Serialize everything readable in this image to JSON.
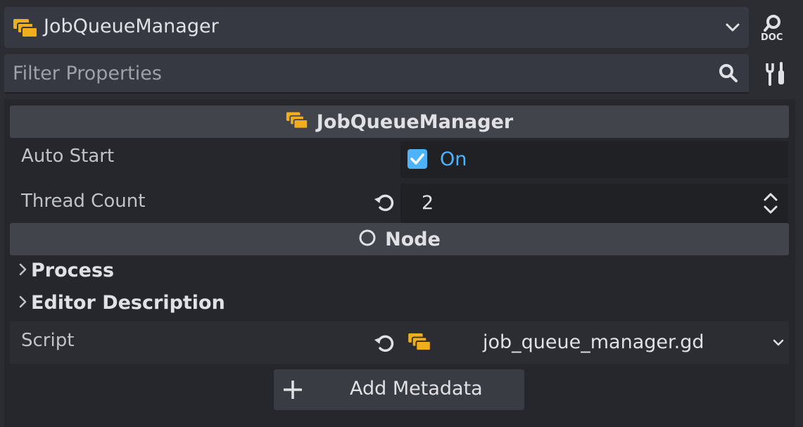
{
  "selector": {
    "title": "JobQueueManager",
    "icon": "script-class-icon",
    "accent": "#f5a623"
  },
  "filter": {
    "placeholder": "Filter Properties"
  },
  "sections": {
    "class_header": "JobQueueManager",
    "node_header": "Node"
  },
  "properties": {
    "auto_start": {
      "label": "Auto Start",
      "value": "On",
      "checked": true
    },
    "thread_count": {
      "label": "Thread Count",
      "value": "2"
    },
    "script": {
      "label": "Script",
      "value": "job_queue_manager.gd"
    }
  },
  "groups": {
    "process": "Process",
    "editor_description": "Editor Description"
  },
  "add_metadata": "Add Metadata",
  "colors": {
    "accent_blue": "#4db3ff",
    "icon_orange": "#f0ad1c"
  }
}
